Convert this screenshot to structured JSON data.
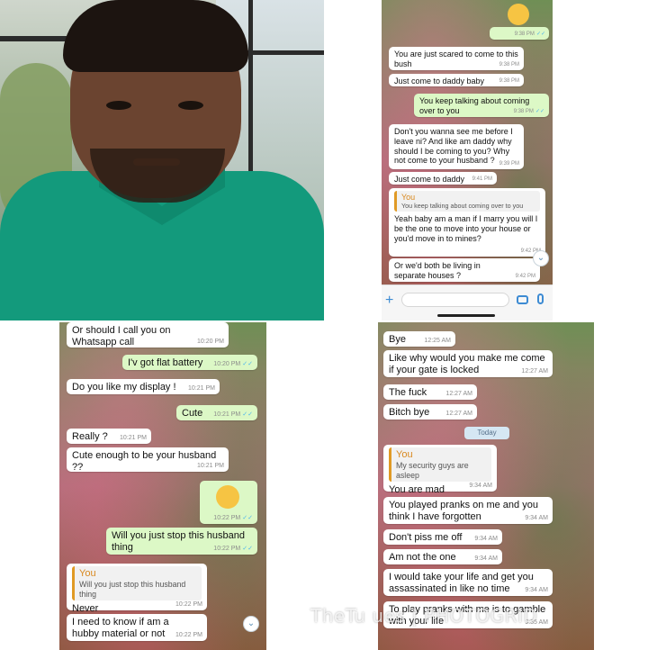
{
  "watermark": "TheTu  ues | PHOTOGRID",
  "panel_top_right": {
    "partial_top_time": "9:38 PM",
    "messages": [
      {
        "dir": "in",
        "text": "You are just scared to come to this bush",
        "time": "9:38 PM"
      },
      {
        "dir": "in",
        "text": "Just come to daddy baby",
        "time": "9:38 PM"
      },
      {
        "dir": "out",
        "text": "You keep talking about coming over to you",
        "time": "9:38 PM"
      },
      {
        "dir": "in",
        "text": "Don't you wanna see me before I leave ni? And like am daddy why should I be coming to you? Why not come to your husband ?",
        "time": "9:39 PM"
      },
      {
        "dir": "in",
        "text": "Just come to daddy",
        "time": "9:41 PM"
      },
      {
        "dir": "in",
        "quote_author": "You",
        "quote_text": "You keep talking about coming over to you",
        "text": "Yeah baby am a man if I marry you will I be the one to move into your house or you'd move in to mines?",
        "time": "9:42 PM"
      },
      {
        "dir": "in",
        "text": "Or we'd both be living in separate houses ?",
        "time": "9:42 PM"
      }
    ]
  },
  "panel_bottom_left": {
    "messages": [
      {
        "dir": "in",
        "text": "Or should I call you on Whatsapp call",
        "time": "10:20 PM"
      },
      {
        "dir": "out",
        "text": "I'v got flat battery",
        "time": "10:20 PM"
      },
      {
        "dir": "in",
        "text": "Do you like my display !",
        "time": "10:21 PM"
      },
      {
        "dir": "out",
        "text": "Cute",
        "time": "10:21 PM"
      },
      {
        "dir": "in",
        "text": "Really ?",
        "time": "10:21 PM"
      },
      {
        "dir": "in",
        "text": "Cute enough to be your husband ??",
        "time": "10:21 PM"
      },
      {
        "dir": "out",
        "text": "",
        "emoji": "laughing-emoji",
        "time": "10:22 PM"
      },
      {
        "dir": "out",
        "text": "Will you just stop this husband thing",
        "time": "10:22 PM"
      },
      {
        "dir": "in",
        "quote_author": "You",
        "quote_text": "Will you just stop this husband thing",
        "text": "Never",
        "time": "10:22 PM"
      },
      {
        "dir": "in",
        "text": "I need to know if am a hubby material or not",
        "time": "10:22 PM"
      }
    ]
  },
  "panel_bottom_right": {
    "date_separator": "Today",
    "messages": [
      {
        "dir": "in",
        "text": "Bye",
        "time": "12:25 AM"
      },
      {
        "dir": "in",
        "text": "Like why would you make me come if your gate is locked",
        "time": "12:27 AM"
      },
      {
        "dir": "in",
        "text": "The fuck",
        "time": "12:27 AM"
      },
      {
        "dir": "in",
        "text": "Bitch bye",
        "time": "12:27 AM"
      },
      {
        "dir": "in",
        "quote_author": "You",
        "quote_text": "My security guys are asleep",
        "text": "You are mad",
        "time": "9:34 AM"
      },
      {
        "dir": "in",
        "text": "You played pranks on me and you think I have forgotten",
        "time": "9:34 AM"
      },
      {
        "dir": "in",
        "text": "Don't piss me off",
        "time": "9:34 AM"
      },
      {
        "dir": "in",
        "text": "Am not the one",
        "time": "9:34 AM"
      },
      {
        "dir": "in",
        "text": "I would take your life and get you assassinated in like no time",
        "time": "9:34 AM"
      },
      {
        "dir": "in",
        "text": "To play pranks with me is to gamble with your life",
        "time": "9:35 AM"
      }
    ]
  },
  "icons": {
    "ticks": "✓✓",
    "scroll_down": "⌄",
    "plus": "+"
  },
  "colors": {
    "incoming": "#ffffff",
    "outgoing": "#dcf8c6",
    "quote_accent": "#e09a25",
    "tick_blue": "#4fb6ec",
    "shirt": "#139a7c"
  }
}
